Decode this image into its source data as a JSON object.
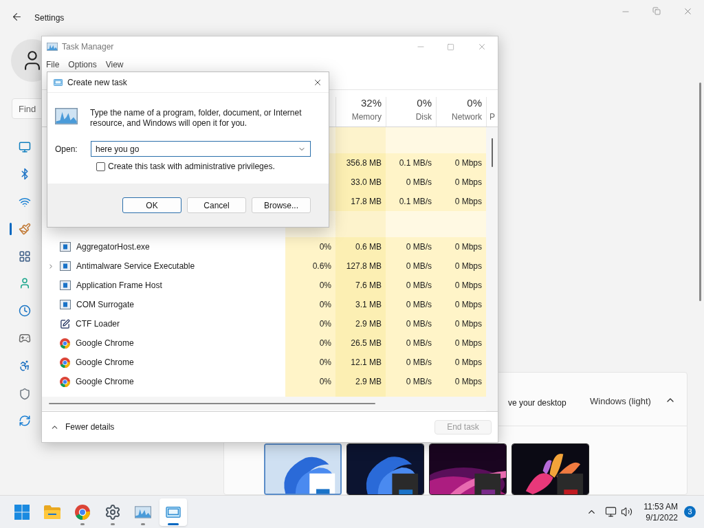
{
  "settings": {
    "title": "Settings",
    "search": {
      "placeholder": "Find"
    },
    "sidebar": [
      {
        "kind": "display",
        "selected": false
      },
      {
        "kind": "bluetooth",
        "selected": false
      },
      {
        "kind": "network",
        "selected": false
      },
      {
        "kind": "personalization",
        "selected": true
      },
      {
        "kind": "apps",
        "selected": false
      },
      {
        "kind": "accounts",
        "selected": false
      },
      {
        "kind": "time",
        "selected": false
      },
      {
        "kind": "gaming",
        "selected": false
      },
      {
        "kind": "accessibility",
        "selected": false
      },
      {
        "kind": "privacy",
        "selected": false
      },
      {
        "kind": "update",
        "selected": false
      }
    ],
    "theme_card": {
      "label": "ve your desktop",
      "value": "Windows (light)",
      "expanded": true
    },
    "themes": [
      {
        "kind": "light",
        "selected": true
      },
      {
        "kind": "dark",
        "selected": false
      },
      {
        "kind": "glow",
        "selected": false
      },
      {
        "kind": "flower",
        "selected": false
      }
    ]
  },
  "task_manager": {
    "title": "Task Manager",
    "menu": [
      "File",
      "Options",
      "View"
    ],
    "columns": [
      {
        "percent": "32%",
        "label": "Memory"
      },
      {
        "percent": "0%",
        "label": "Disk"
      },
      {
        "percent": "0%",
        "label": "Network"
      },
      {
        "label": "P"
      }
    ],
    "app_rows": [
      {
        "memory": "356.8 MB",
        "disk": "0.1 MB/s",
        "network": "0 Mbps"
      },
      {
        "memory": "33.0 MB",
        "disk": "0 MB/s",
        "network": "0 Mbps"
      },
      {
        "memory": "17.8 MB",
        "disk": "0.1 MB/s",
        "network": "0 Mbps"
      }
    ],
    "processes": [
      {
        "kind": "window",
        "name": "AggregatorHost.exe",
        "expandable": false,
        "cpu": "0%",
        "memory": "0.6 MB",
        "disk": "0 MB/s",
        "network": "0 Mbps"
      },
      {
        "kind": "window",
        "name": "Antimalware Service Executable",
        "expandable": true,
        "cpu": "0.6%",
        "memory": "127.8 MB",
        "disk": "0 MB/s",
        "network": "0 Mbps"
      },
      {
        "kind": "window",
        "name": "Application Frame Host",
        "expandable": false,
        "cpu": "0%",
        "memory": "7.6 MB",
        "disk": "0 MB/s",
        "network": "0 Mbps"
      },
      {
        "kind": "window",
        "name": "COM Surrogate",
        "expandable": false,
        "cpu": "0%",
        "memory": "3.1 MB",
        "disk": "0 MB/s",
        "network": "0 Mbps"
      },
      {
        "kind": "pen",
        "name": "CTF Loader",
        "expandable": false,
        "cpu": "0%",
        "memory": "2.9 MB",
        "disk": "0 MB/s",
        "network": "0 Mbps"
      },
      {
        "kind": "chrome",
        "name": "Google Chrome",
        "expandable": false,
        "cpu": "0%",
        "memory": "26.5 MB",
        "disk": "0 MB/s",
        "network": "0 Mbps"
      },
      {
        "kind": "chrome",
        "name": "Google Chrome",
        "expandable": false,
        "cpu": "0%",
        "memory": "12.1 MB",
        "disk": "0 MB/s",
        "network": "0 Mbps"
      },
      {
        "kind": "chrome",
        "name": "Google Chrome",
        "expandable": false,
        "cpu": "0%",
        "memory": "2.9 MB",
        "disk": "0 MB/s",
        "network": "0 Mbps"
      }
    ],
    "footer": {
      "toggle": "Fewer details",
      "end_task": {
        "label": "End task",
        "disabled": true
      }
    }
  },
  "dialog": {
    "title": "Create new task",
    "message": "Type the name of a program, folder, document, or Internet resource, and Windows will open it for you.",
    "open_label": "Open:",
    "value": "here you go",
    "checkbox": {
      "label": "Create this task with administrative privileges.",
      "checked": false
    },
    "buttons": [
      {
        "label": "OK",
        "default": true
      },
      {
        "label": "Cancel",
        "default": false
      },
      {
        "label": "Browse...",
        "default": false
      }
    ]
  },
  "taskbar": {
    "apps": [
      {
        "kind": "start",
        "running": false,
        "selected": false
      },
      {
        "kind": "explorer",
        "running": false,
        "selected": false
      },
      {
        "kind": "chrome",
        "running": true,
        "selected": false
      },
      {
        "kind": "settings",
        "running": true,
        "selected": false
      },
      {
        "kind": "taskmanager",
        "running": true,
        "selected": false
      },
      {
        "kind": "run",
        "running": true,
        "selected": true
      }
    ],
    "tray": {
      "time": "11:53 AM",
      "date": "9/1/2022",
      "badge": "3"
    }
  }
}
